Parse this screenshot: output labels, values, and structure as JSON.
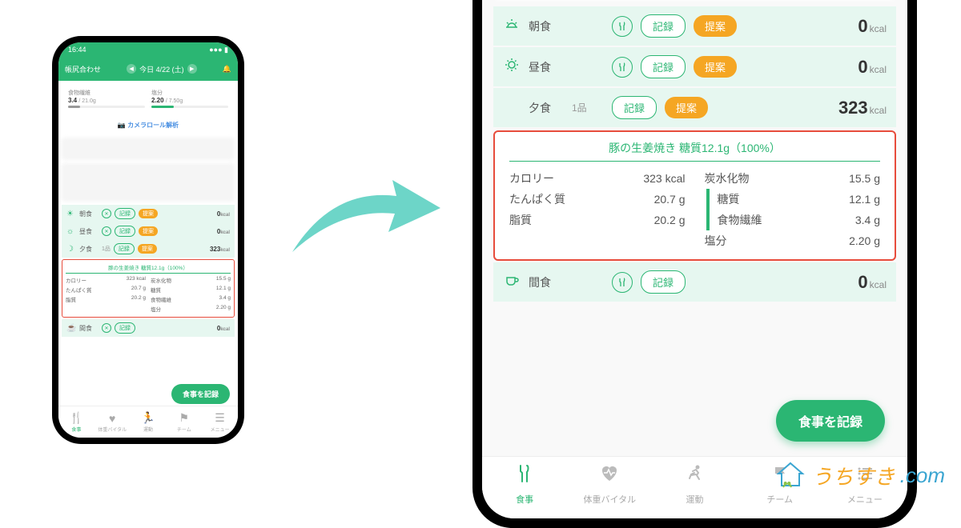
{
  "status_time": "16:44",
  "header": {
    "title": "帳尻合わせ",
    "date": "今日 4/22 (土)"
  },
  "nutrition_summary": {
    "fiber": {
      "label": "食物繊維",
      "value": "3.4",
      "target": "/ 21.0g"
    },
    "salt": {
      "label": "塩分",
      "value": "2.20",
      "target": "/ 7.50g"
    }
  },
  "camera_label": "カメラロール解析",
  "meals": [
    {
      "icon": "sunrise",
      "name": "朝食",
      "count": "",
      "kcal": "0",
      "suggest": true
    },
    {
      "icon": "sun",
      "name": "昼食",
      "count": "",
      "kcal": "0",
      "suggest": true
    },
    {
      "icon": "moon",
      "name": "夕食",
      "count": "1品",
      "kcal": "323",
      "suggest": true
    },
    {
      "icon": "cup",
      "name": "間食",
      "count": "",
      "kcal": "0",
      "suggest": false
    }
  ],
  "buttons": {
    "record": "記録",
    "suggest": "提案"
  },
  "kcal_unit": "kcal",
  "detail": {
    "title": "豚の生姜焼き 糖質12.1g（100%）",
    "left": [
      {
        "label": "カロリー",
        "value": "323 kcal"
      },
      {
        "label": "たんぱく質",
        "value": "20.7 g"
      },
      {
        "label": "脂質",
        "value": "20.2 g"
      }
    ],
    "right": [
      {
        "label": "炭水化物",
        "value": "15.5 g",
        "indent": false
      },
      {
        "label": "糖質",
        "value": "12.1 g",
        "indent": true
      },
      {
        "label": "食物繊維",
        "value": "3.4 g",
        "indent": true
      },
      {
        "label": "塩分",
        "value": "2.20 g",
        "indent": false
      }
    ]
  },
  "record_meal_btn": "食事を記録",
  "tabs": [
    {
      "label": "食事",
      "icon": "utensils",
      "active": true
    },
    {
      "label": "体重バイタル",
      "icon": "heart",
      "active": false
    },
    {
      "label": "運動",
      "icon": "run",
      "active": false
    },
    {
      "label": "チーム",
      "icon": "flag",
      "active": false
    },
    {
      "label": "メニュー",
      "icon": "menu",
      "active": false
    }
  ],
  "watermark": {
    "text1": "うちすき",
    "text2": ".com"
  }
}
